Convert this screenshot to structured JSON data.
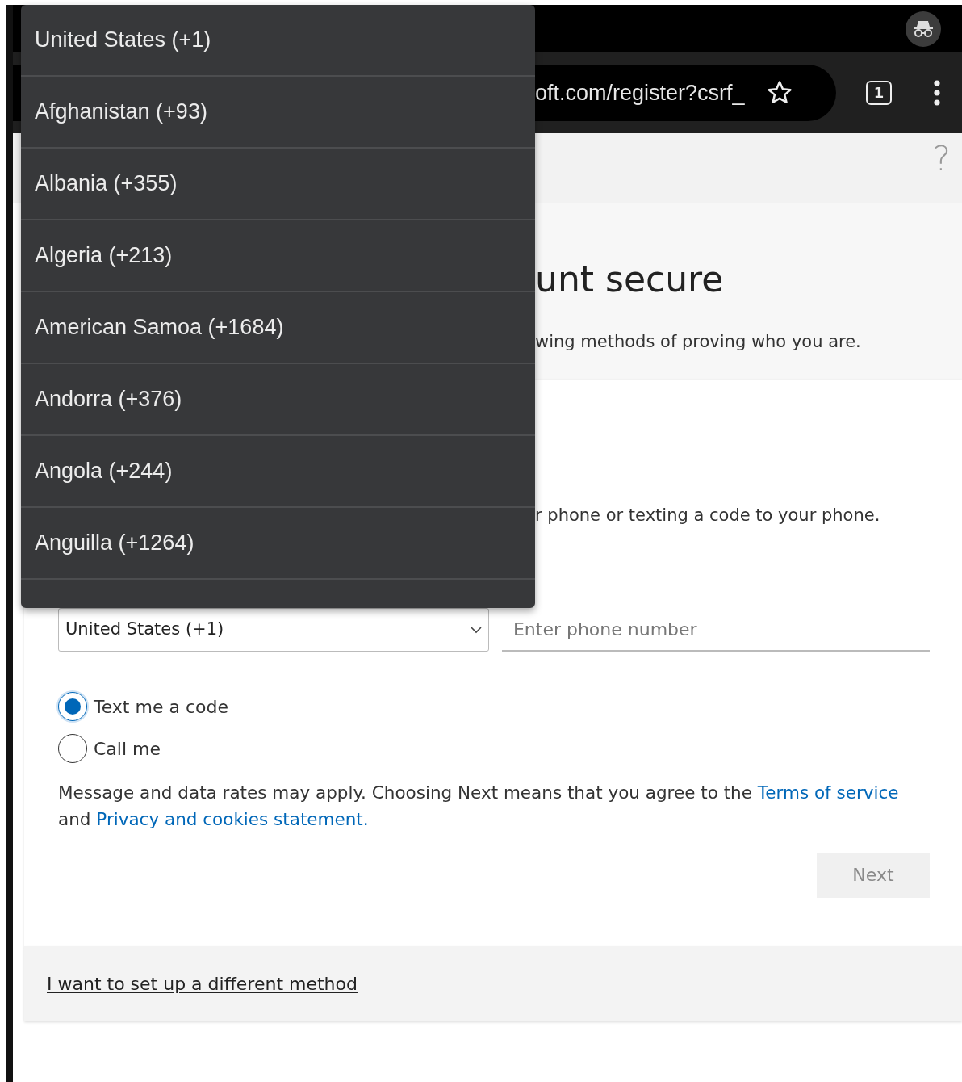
{
  "browser": {
    "url": "oft.com/register?csrf_",
    "tab_count": "1"
  },
  "page": {
    "help": "?",
    "title": "unt secure",
    "subtitle": "wing methods of proving who you are.",
    "description": "r phone or texting a code to your phone.",
    "country_select": {
      "value": "United States (+1)"
    },
    "phone": {
      "placeholder": "Enter phone number"
    },
    "options": [
      {
        "label": "Text me a code",
        "selected": true
      },
      {
        "label": "Call me",
        "selected": false
      }
    ],
    "notice": [
      {
        "kind": "text",
        "text": "Message and data rates may apply. Choosing Next means that you agree to the "
      },
      {
        "kind": "link",
        "text": "Terms of service"
      },
      {
        "kind": "text",
        "text": " and "
      },
      {
        "kind": "link",
        "text": "Privacy and cookies statement."
      }
    ],
    "next_button": {
      "label": "Next",
      "disabled": true
    },
    "footer_link": "I want to set up a different method"
  },
  "dropdown": {
    "items": [
      {
        "label": "United States (+1)"
      },
      {
        "label": "Afghanistan (+93)"
      },
      {
        "label": "Albania (+355)"
      },
      {
        "label": "Algeria (+213)"
      },
      {
        "label": "American Samoa (+1684)"
      },
      {
        "label": "Andorra (+376)"
      },
      {
        "label": "Angola (+244)"
      },
      {
        "label": "Anguilla (+1264)"
      }
    ]
  }
}
